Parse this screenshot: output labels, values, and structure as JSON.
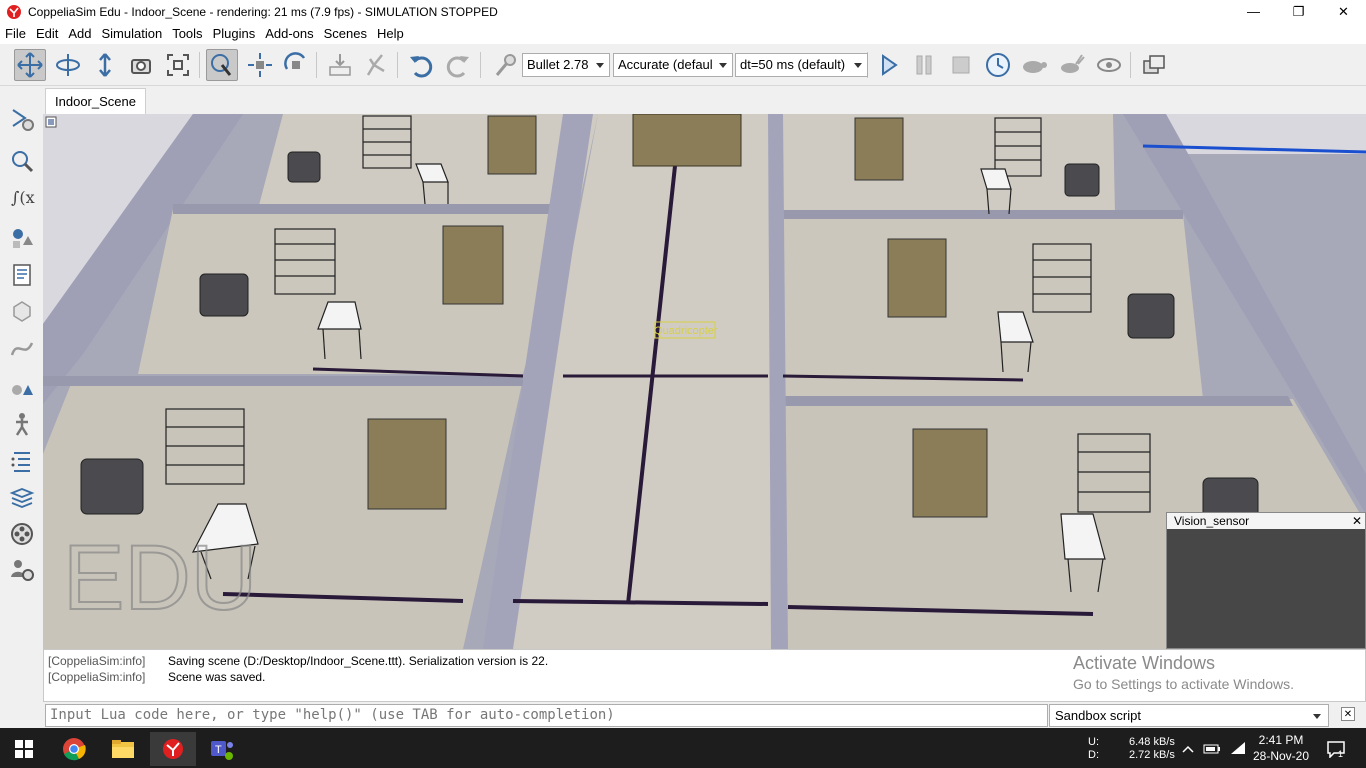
{
  "window": {
    "title": "CoppeliaSim Edu - Indoor_Scene - rendering: 21 ms (7.9 fps) - SIMULATION STOPPED",
    "minimize": "—",
    "restore": "❐",
    "close": "✕"
  },
  "menu": [
    "File",
    "Edit",
    "Add",
    "Simulation",
    "Tools",
    "Plugins",
    "Add-ons",
    "Scenes",
    "Help"
  ],
  "toolbar": {
    "physics_engine": "Bullet 2.78",
    "accuracy": "Accurate (defaul",
    "dt": "dt=50 ms (default)",
    "buttons": [
      "camera-pan",
      "camera-rotate",
      "camera-shift",
      "camera-angle",
      "fit-to-view",
      "click-select",
      "object-shift",
      "object-rotate",
      "undo",
      "redo",
      "assemble",
      "transfer-dna",
      "start-simulation",
      "pause-simulation",
      "stop-simulation",
      "real-time",
      "slow-down",
      "speed-up",
      "visualization-toggle",
      "page-selector"
    ]
  },
  "sidebar": [
    "scene-object-properties",
    "calculation-modules",
    "collections",
    "scripts",
    "shapes-edit",
    "path-edit",
    "selection",
    "model-browser",
    "scene-hierarchy",
    "layers",
    "video-recorder",
    "user-settings"
  ],
  "tabs": [
    {
      "label": "Indoor_Scene"
    }
  ],
  "viewport": {
    "watermark": "EDU",
    "object_label": "Quadricopter",
    "colors": {
      "floor": "#cfcbc2",
      "wall": "#9fa0b5",
      "cabinet": "#8b7d58",
      "sky": "#d8d8de"
    }
  },
  "vision_sensor": {
    "title": "Vision_sensor",
    "close": "✕"
  },
  "console": {
    "lines": [
      {
        "source": "[CoppeliaSim:info]",
        "text": "Saving scene (D:/Desktop/Indoor_Scene.ttt). Serialization version is 22."
      },
      {
        "source": "[CoppeliaSim:info]",
        "text": "Scene was saved."
      }
    ]
  },
  "activation": {
    "title": "Activate Windows",
    "subtitle": "Go to Settings to activate Windows."
  },
  "lua": {
    "placeholder": "Input Lua code here, or type \"help()\" (use TAB for auto-completion)",
    "script_selector": "Sandbox script"
  },
  "taskbar": {
    "apps": [
      "windows-start",
      "chrome",
      "file-explorer",
      "coppeliasim",
      "teams"
    ],
    "net_labels": [
      "U:",
      "D:"
    ],
    "net_values": [
      "6.48 kB/s",
      "2.72 kB/s"
    ],
    "time": "2:41 PM",
    "date": "28-Nov-20"
  }
}
